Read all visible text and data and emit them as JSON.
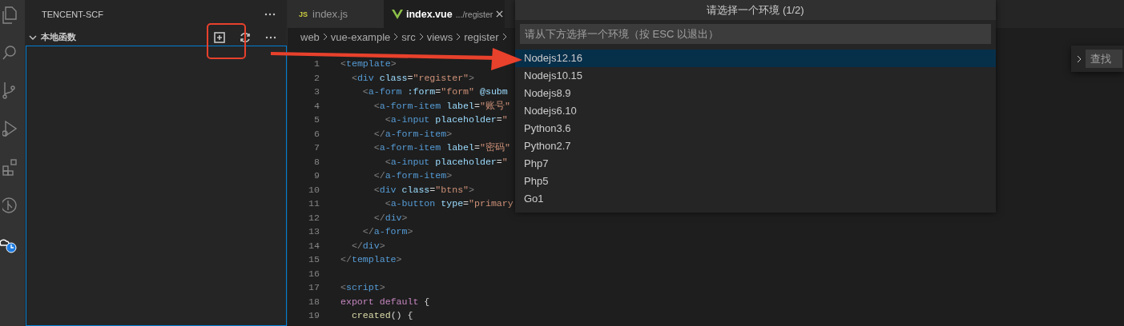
{
  "sidebar": {
    "title": "TENCENT-SCF",
    "section": {
      "title": "本地函数",
      "expanded": true
    }
  },
  "tabs": [
    {
      "badge": "JS",
      "label": "index.js",
      "selected": false
    },
    {
      "label": "index.vue",
      "description": ".../register",
      "selected": true
    }
  ],
  "breadcrumbs": [
    "web",
    "vue-example",
    "src",
    "views",
    "register"
  ],
  "editor": {
    "lines": [
      {
        "number": "1",
        "tokens": [
          {
            "text": "<",
            "kind": "punct"
          },
          {
            "text": "template",
            "kind": "tag"
          },
          {
            "text": ">",
            "kind": "punct"
          }
        ]
      },
      {
        "number": "2",
        "tokens": [
          {
            "text": "  <",
            "kind": "punct"
          },
          {
            "text": "div",
            "kind": "tag"
          },
          {
            "text": " class",
            "kind": "attr"
          },
          {
            "text": "=",
            "kind": "plain"
          },
          {
            "text": "\"register\"",
            "kind": "string"
          },
          {
            "text": ">",
            "kind": "punct"
          }
        ]
      },
      {
        "number": "3",
        "tokens": [
          {
            "text": "    <",
            "kind": "punct"
          },
          {
            "text": "a-form",
            "kind": "tag"
          },
          {
            "text": " :form",
            "kind": "attr"
          },
          {
            "text": "=",
            "kind": "plain"
          },
          {
            "text": "\"form\"",
            "kind": "string"
          },
          {
            "text": " @subm",
            "kind": "attr"
          }
        ]
      },
      {
        "number": "4",
        "tokens": [
          {
            "text": "      <",
            "kind": "punct"
          },
          {
            "text": "a-form-item",
            "kind": "tag"
          },
          {
            "text": " label",
            "kind": "attr"
          },
          {
            "text": "=",
            "kind": "plain"
          },
          {
            "text": "\"账号\"",
            "kind": "string"
          }
        ]
      },
      {
        "number": "5",
        "tokens": [
          {
            "text": "        <",
            "kind": "punct"
          },
          {
            "text": "a-input",
            "kind": "tag"
          },
          {
            "text": " placeholder",
            "kind": "attr"
          },
          {
            "text": "=",
            "kind": "plain"
          },
          {
            "text": "\"",
            "kind": "string"
          }
        ]
      },
      {
        "number": "6",
        "tokens": [
          {
            "text": "      </",
            "kind": "punct"
          },
          {
            "text": "a-form-item",
            "kind": "tag"
          },
          {
            "text": ">",
            "kind": "punct"
          }
        ]
      },
      {
        "number": "7",
        "tokens": [
          {
            "text": "      <",
            "kind": "punct"
          },
          {
            "text": "a-form-item",
            "kind": "tag"
          },
          {
            "text": " label",
            "kind": "attr"
          },
          {
            "text": "=",
            "kind": "plain"
          },
          {
            "text": "\"密码\"",
            "kind": "string"
          }
        ]
      },
      {
        "number": "8",
        "tokens": [
          {
            "text": "        <",
            "kind": "punct"
          },
          {
            "text": "a-input",
            "kind": "tag"
          },
          {
            "text": " placeholder",
            "kind": "attr"
          },
          {
            "text": "=",
            "kind": "plain"
          },
          {
            "text": "\"",
            "kind": "string"
          }
        ]
      },
      {
        "number": "9",
        "tokens": [
          {
            "text": "      </",
            "kind": "punct"
          },
          {
            "text": "a-form-item",
            "kind": "tag"
          },
          {
            "text": ">",
            "kind": "punct"
          }
        ]
      },
      {
        "number": "10",
        "tokens": [
          {
            "text": "      <",
            "kind": "punct"
          },
          {
            "text": "div",
            "kind": "tag"
          },
          {
            "text": " class",
            "kind": "attr"
          },
          {
            "text": "=",
            "kind": "plain"
          },
          {
            "text": "\"btns\"",
            "kind": "string"
          },
          {
            "text": ">",
            "kind": "punct"
          }
        ]
      },
      {
        "number": "11",
        "tokens": [
          {
            "text": "        <",
            "kind": "punct"
          },
          {
            "text": "a-button",
            "kind": "tag"
          },
          {
            "text": " type",
            "kind": "attr"
          },
          {
            "text": "=",
            "kind": "plain"
          },
          {
            "text": "\"primary",
            "kind": "string"
          }
        ]
      },
      {
        "number": "12",
        "tokens": [
          {
            "text": "      </",
            "kind": "punct"
          },
          {
            "text": "div",
            "kind": "tag"
          },
          {
            "text": ">",
            "kind": "punct"
          }
        ]
      },
      {
        "number": "13",
        "tokens": [
          {
            "text": "    </",
            "kind": "punct"
          },
          {
            "text": "a-form",
            "kind": "tag"
          },
          {
            "text": ">",
            "kind": "punct"
          }
        ]
      },
      {
        "number": "14",
        "tokens": [
          {
            "text": "  </",
            "kind": "punct"
          },
          {
            "text": "div",
            "kind": "tag"
          },
          {
            "text": ">",
            "kind": "punct"
          }
        ]
      },
      {
        "number": "15",
        "tokens": [
          {
            "text": "</",
            "kind": "punct"
          },
          {
            "text": "template",
            "kind": "tag"
          },
          {
            "text": ">",
            "kind": "punct"
          }
        ]
      },
      {
        "number": "16"
      },
      {
        "number": "17",
        "tokens": [
          {
            "text": "<",
            "kind": "punct"
          },
          {
            "text": "script",
            "kind": "tag"
          },
          {
            "text": ">",
            "kind": "punct"
          }
        ]
      },
      {
        "number": "18",
        "tokens": [
          {
            "text": "export default",
            "kind": "keyword"
          },
          {
            "text": " {",
            "kind": "plain"
          }
        ]
      },
      {
        "number": "19",
        "tokens": [
          {
            "text": "  created",
            "kind": "func"
          },
          {
            "text": "() {",
            "kind": "plain"
          }
        ]
      }
    ]
  },
  "quick_pick": {
    "title": "请选择一个环境 (1/2)",
    "placeholder": "请从下方选择一个环境（按 ESC 以退出）",
    "items": [
      {
        "label": "Nodejs12.16",
        "selected": true
      },
      {
        "label": "Nodejs10.15",
        "selected": false
      },
      {
        "label": "Nodejs8.9",
        "selected": false
      },
      {
        "label": "Nodejs6.10",
        "selected": false
      },
      {
        "label": "Python3.6",
        "selected": false
      },
      {
        "label": "Python2.7",
        "selected": false
      },
      {
        "label": "Php7",
        "selected": false
      },
      {
        "label": "Php5",
        "selected": false
      },
      {
        "label": "Go1",
        "selected": false
      }
    ]
  },
  "find_widget": {
    "placeholder": "查找",
    "expanded": false
  }
}
